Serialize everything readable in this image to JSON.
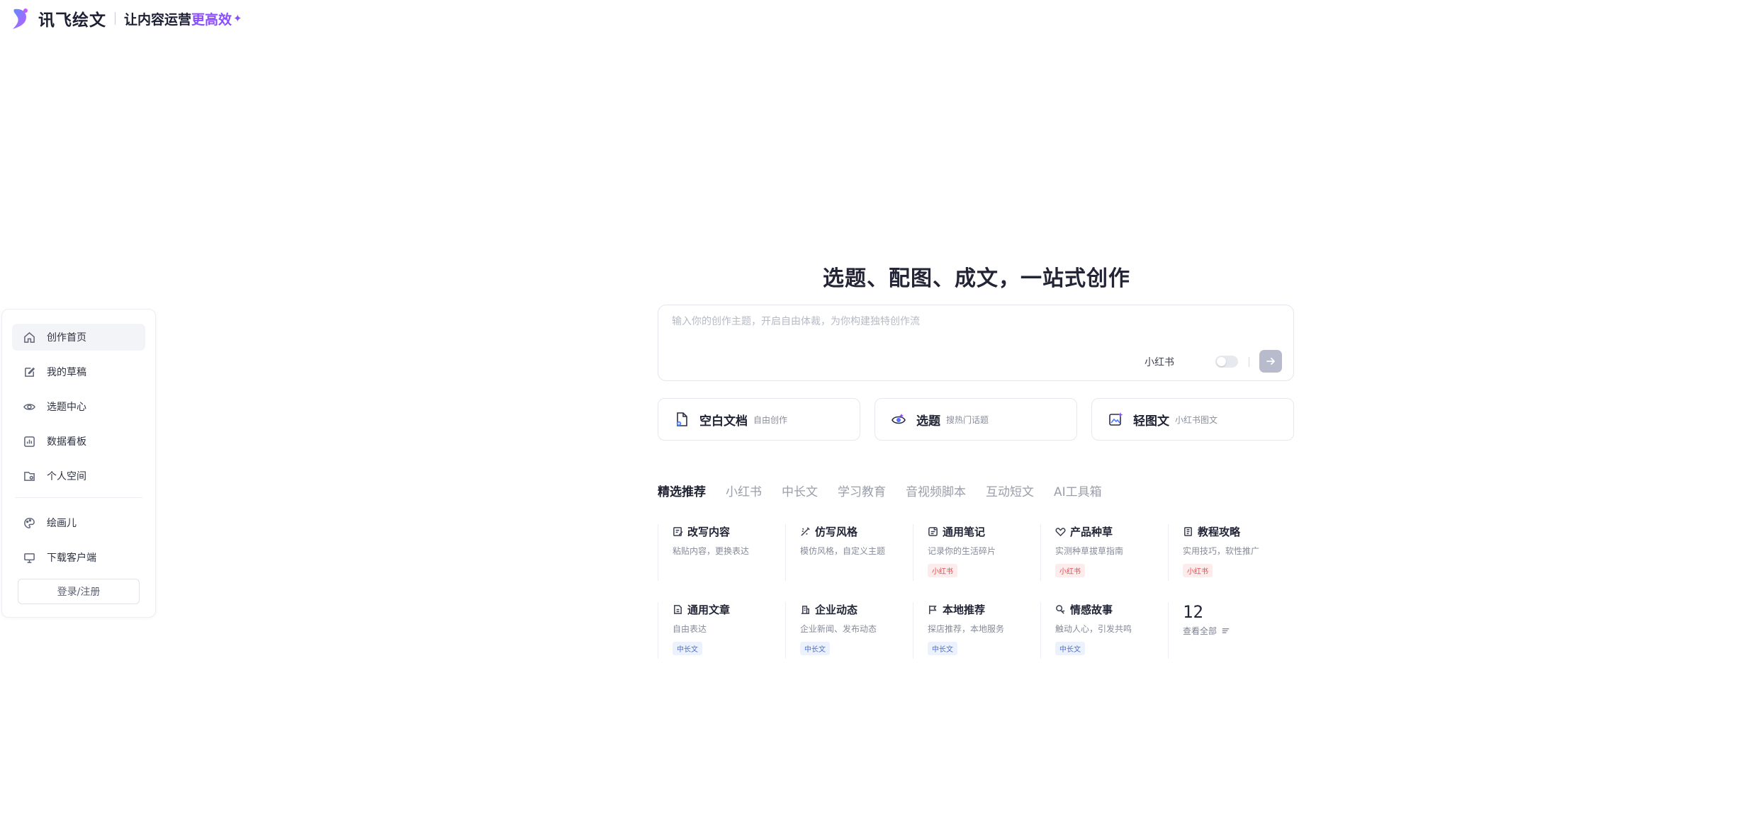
{
  "brand": {
    "name": "讯飞绘文",
    "slogan": "让内容运营",
    "slogan_accent": "更高效",
    "accent_color": "#8a4dff"
  },
  "sidebar": {
    "items": [
      {
        "label": "创作首页",
        "icon": "home-icon",
        "active": true
      },
      {
        "label": "我的草稿",
        "icon": "edit-icon"
      },
      {
        "label": "选题中心",
        "icon": "eye-icon"
      },
      {
        "label": "数据看板",
        "icon": "chart-icon"
      },
      {
        "label": "个人空间",
        "icon": "folder-icon"
      }
    ],
    "extra_items": [
      {
        "label": "绘画儿",
        "icon": "palette-icon"
      },
      {
        "label": "下载客户端",
        "icon": "monitor-icon"
      }
    ],
    "login_label": "登录/注册"
  },
  "hero": {
    "title": "选题、配图、成文，一站式创作",
    "input_placeholder": "输入你的创作主题，开启自由体裁，为你构建独特创作流",
    "toggle_label": "小红书",
    "toggle_on": false
  },
  "actions": [
    {
      "title": "空白文档",
      "sub": "自由创作",
      "icon": "doc-icon"
    },
    {
      "title": "选题",
      "sub": "搜热门话题",
      "icon": "eye-topic-icon"
    },
    {
      "title": "轻图文",
      "sub": "小红书图文",
      "icon": "image-spark-icon"
    }
  ],
  "tabs": [
    "精选推荐",
    "小红书",
    "中长文",
    "学习教育",
    "音视频脚本",
    "互动短文",
    "AI工具箱"
  ],
  "templates": [
    {
      "title": "改写内容",
      "desc": "粘贴内容，更换表达",
      "tag": "",
      "icon": "rewrite-icon"
    },
    {
      "title": "仿写风格",
      "desc": "模仿风格，自定义主题",
      "tag": "",
      "icon": "wand-icon"
    },
    {
      "title": "通用笔记",
      "desc": "记录你的生活碎片",
      "tag": "小红书",
      "tag_type": "red",
      "icon": "note-icon"
    },
    {
      "title": "产品种草",
      "desc": "实测种草拔草指南",
      "tag": "小红书",
      "tag_type": "red",
      "icon": "heart-icon"
    },
    {
      "title": "教程攻略",
      "desc": "实用技巧，软性推广",
      "tag": "小红书",
      "tag_type": "red",
      "icon": "book-icon"
    },
    {
      "title": "通用文章",
      "desc": "自由表达",
      "tag": "中长文",
      "tag_type": "blue",
      "icon": "article-icon"
    },
    {
      "title": "企业动态",
      "desc": "企业新闻、发布动态",
      "tag": "中长文",
      "tag_type": "blue",
      "icon": "building-icon"
    },
    {
      "title": "本地推荐",
      "desc": "探店推荐，本地服务",
      "tag": "中长文",
      "tag_type": "blue",
      "icon": "flag-icon"
    },
    {
      "title": "情感故事",
      "desc": "触动人心，引发共鸣",
      "tag": "中长文",
      "tag_type": "blue",
      "icon": "story-icon"
    }
  ],
  "view_all": {
    "count": "12",
    "label": "查看全部"
  }
}
